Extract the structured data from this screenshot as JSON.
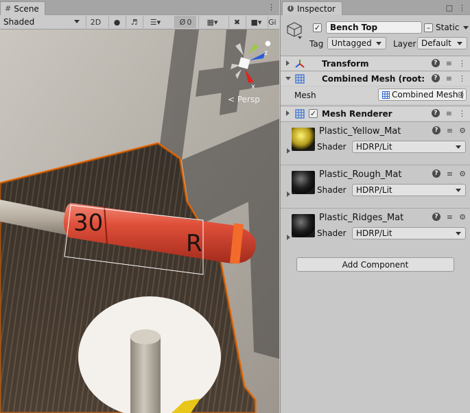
{
  "scene": {
    "tab_label": "Scene",
    "shading_mode": "Shaded",
    "btn_2d": "2D",
    "visibility_count": "0",
    "gizmos_label": "Gi",
    "persp_label": "< Persp",
    "ruler_labels": [
      "30",
      "R"
    ],
    "axis_labels": {
      "y": "y",
      "z": "z",
      "x": "x"
    }
  },
  "inspector": {
    "tab_label": "Inspector",
    "object": {
      "active": true,
      "name": "Bench Top",
      "static_label": "Static",
      "tag_label": "Tag",
      "tag_value": "Untagged",
      "layer_label": "Layer",
      "layer_value": "Default"
    },
    "components": {
      "transform": {
        "title": "Transform"
      },
      "combined_mesh": {
        "title": "Combined Mesh (root: sce",
        "mesh_label": "Mesh",
        "mesh_value": "Combined Mesh ("
      },
      "mesh_renderer": {
        "title": "Mesh Renderer",
        "enabled": true
      }
    },
    "materials": [
      {
        "name": "Plastic_Yellow_Mat",
        "shader_label": "Shader",
        "shader": "HDRP/Lit",
        "color": "#b39a1a"
      },
      {
        "name": "Plastic_Rough_Mat",
        "shader_label": "Shader",
        "shader": "HDRP/Lit",
        "color": "#1e1e1e"
      },
      {
        "name": "Plastic_Ridges_Mat",
        "shader_label": "Shader",
        "shader": "HDRP/Lit",
        "color": "#1e1e1e"
      }
    ],
    "add_component_label": "Add Component"
  },
  "colors": {
    "selection_outline": "#f06a00",
    "ruler_red": "#d9412b",
    "axis_x": "#e0241c",
    "axis_y": "#7ab800",
    "axis_z": "#2b5bd8"
  }
}
